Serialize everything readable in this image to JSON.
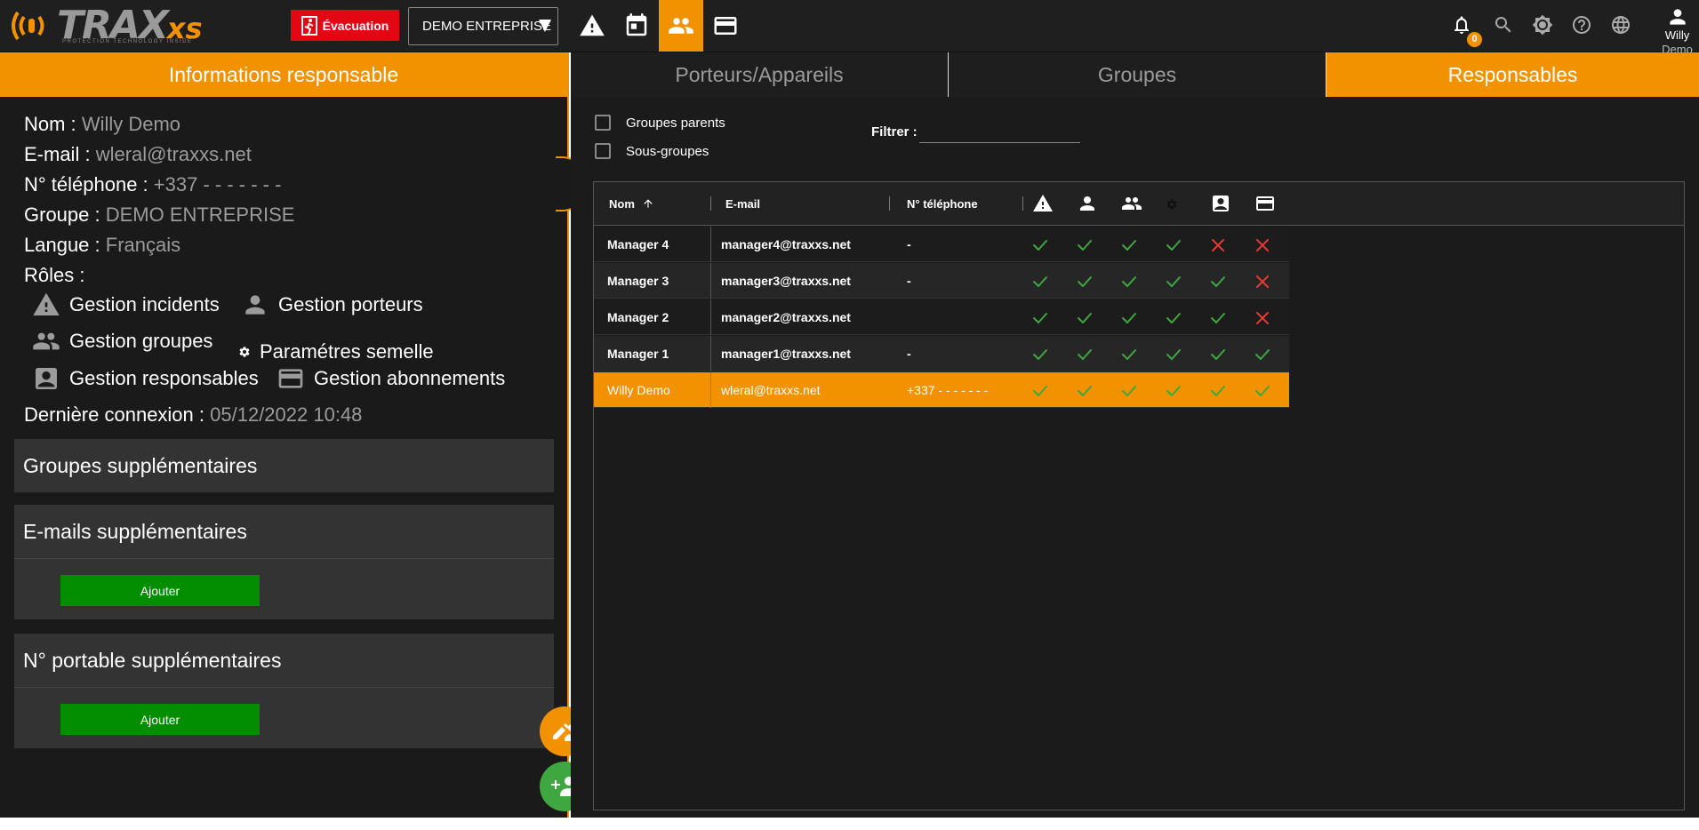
{
  "colors": {
    "accent": "#f39200",
    "evacuation": "#e30613",
    "add_button": "#038d00",
    "check": "#3fa73f",
    "cross": "#e53935"
  },
  "topbar": {
    "logo_text": "TRAX",
    "logo_suffix": "xs",
    "logo_tagline": "PROTECTION TECHNOLOGY INSIDE",
    "evacuation_label": "Évacuation",
    "company_select": "DEMO ENTREPRISE",
    "nav_icons": [
      "warning-icon",
      "calendar-icon",
      "group-icon",
      "card-icon"
    ],
    "active_nav": "group-icon",
    "notifications_count": "0",
    "right_icons": [
      "bell-icon",
      "search-icon",
      "brightness-icon",
      "help-icon",
      "globe-icon"
    ],
    "user_first": "Willy",
    "user_last": "Demo"
  },
  "left": {
    "title": "Informations responsable",
    "nom_label": "Nom :",
    "nom_value": "Willy Demo",
    "email_label": "E-mail :",
    "email_value": "wleral@traxxs.net",
    "tel_label": "N° téléphone :",
    "tel_value": "+337 - - - - - - -",
    "groupe_label": "Groupe :",
    "groupe_value": "DEMO ENTREPRISE",
    "langue_label": "Langue :",
    "langue_value": "Français",
    "roles_label": "Rôles :",
    "roles": {
      "incidents": "Gestion incidents",
      "porteurs": "Gestion porteurs",
      "groupes": "Gestion groupes",
      "semelle": "Paramétres semelle",
      "responsables": "Gestion responsables",
      "abonnements": "Gestion abonnements"
    },
    "last_login_label": "Dernière connexion :",
    "last_login_value": "05/12/2022 10:48",
    "groups_section": "Groupes supplémentaires",
    "emails_section": "E-mails supplémentaires",
    "phones_section": "N° portable supplémentaires",
    "add_label": "Ajouter"
  },
  "right": {
    "tabs": [
      "Porteurs/Appareils",
      "Groupes",
      "Responsables"
    ],
    "active_tab": "Responsables",
    "groupes_parents": "Groupes parents",
    "sous_groupes": "Sous-groupes",
    "filter_label": "Filtrer :",
    "filter_value": "",
    "columns": {
      "nom": "Nom",
      "email": "E-mail",
      "tel": "N° téléphone"
    },
    "permission_icons": [
      "warning-icon",
      "person-icon",
      "group-icon",
      "gear-icon",
      "contact-icon",
      "card-icon"
    ],
    "rows": [
      {
        "name": "Manager 4",
        "email": "manager4@traxxs.net",
        "tel": "-",
        "perms": [
          true,
          true,
          true,
          true,
          false,
          false
        ]
      },
      {
        "name": "Manager 3",
        "email": "manager3@traxxs.net",
        "tel": "-",
        "perms": [
          true,
          true,
          true,
          true,
          true,
          false
        ]
      },
      {
        "name": "Manager 2",
        "email": "manager2@traxxs.net",
        "tel": "",
        "perms": [
          true,
          true,
          true,
          true,
          true,
          false
        ]
      },
      {
        "name": "Manager 1",
        "email": "manager1@traxxs.net",
        "tel": "-",
        "perms": [
          true,
          true,
          true,
          true,
          true,
          true
        ]
      },
      {
        "name": "Willy Demo",
        "email": "wleral@traxxs.net",
        "tel": "+337 - - - - - - -",
        "perms": [
          true,
          true,
          true,
          true,
          true,
          true
        ],
        "selected": true
      }
    ]
  }
}
